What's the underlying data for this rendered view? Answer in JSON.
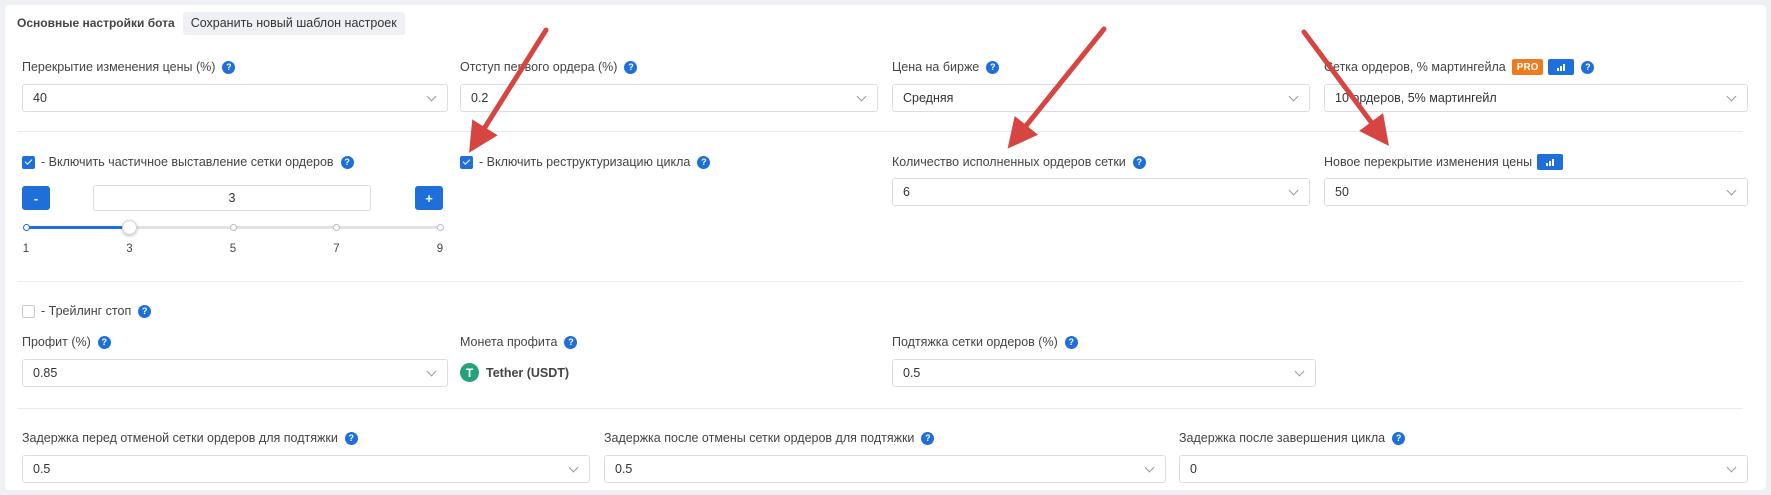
{
  "header": {
    "title": "Основные настройки бота",
    "save_template_label": "Сохранить новый шаблон настроек"
  },
  "row1": {
    "price_overlap": {
      "label": "Перекрытие изменения цены (%)",
      "value": "40"
    },
    "first_order_offset": {
      "label": "Отступ первого ордера (%)",
      "value": "0.2"
    },
    "exchange_price": {
      "label": "Цена на бирже",
      "value": "Средняя"
    },
    "order_grid": {
      "label": "Сетка ордеров, % мартингейла",
      "badge": "PRO",
      "value": "10 ордеров, 5% мартингейл"
    }
  },
  "row2": {
    "partial_grid": {
      "label": "- Включить частичное выставление сетки ордеров",
      "checked": true
    },
    "stepper": {
      "minus": "-",
      "plus": "+",
      "value": "3"
    },
    "slider": {
      "min": 1,
      "max": 9,
      "value": 3,
      "ticks": [
        "1",
        "3",
        "5",
        "7",
        "9"
      ]
    },
    "restructure": {
      "label": "- Включить реструктуризацию цикла",
      "checked": true
    },
    "filled_orders": {
      "label": "Количество исполненных ордеров сетки",
      "value": "6"
    },
    "new_overlap": {
      "label": "Новое перекрытие изменения цены",
      "value": "50"
    }
  },
  "row3": {
    "trailing": {
      "label": "- Трейлинг стоп",
      "checked": false
    },
    "profit": {
      "label": "Профит (%)",
      "value": "0.85"
    },
    "profit_coin": {
      "label": "Монета профита",
      "coin_symbol": "T",
      "coin_name": "Tether (USDT)"
    },
    "grid_pullup": {
      "label": "Подтяжка сетки ордеров (%)",
      "value": "0.5"
    }
  },
  "row4": {
    "delay_before_cancel": {
      "label": "Задержка перед отменой сетки ордеров для подтяжки",
      "value": "0.5"
    },
    "delay_after_cancel": {
      "label": "Задержка после отмены сетки ордеров для подтяжки",
      "value": "0.5"
    },
    "delay_after_cycle": {
      "label": "Задержка после завершения цикла",
      "value": "0"
    }
  },
  "icons": {
    "help": "?"
  },
  "colors": {
    "accent": "#1e6fd9",
    "pro": "#f07b1e",
    "arrow": "#d64541",
    "tether": "#26a17b"
  }
}
